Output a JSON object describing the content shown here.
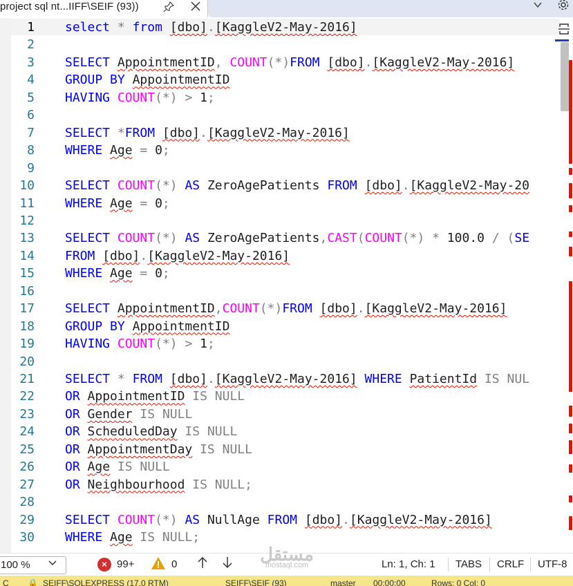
{
  "tab": {
    "title": "project sql nt...IIFF\\SEIF (93))",
    "pin_icon": "pin-icon",
    "close_icon": "close-icon"
  },
  "editor": {
    "lines": [
      {
        "n": "1",
        "code": "select * from [dbo].[KaggleV2-May-2016]"
      },
      {
        "n": "2",
        "code": ""
      },
      {
        "n": "3",
        "code": "SELECT AppointmentID, COUNT(*)FROM [dbo].[KaggleV2-May-2016]"
      },
      {
        "n": "4",
        "code": "GROUP BY AppointmentID"
      },
      {
        "n": "5",
        "code": "HAVING COUNT(*) > 1;"
      },
      {
        "n": "6",
        "code": ""
      },
      {
        "n": "7",
        "code": "SELECT *FROM [dbo].[KaggleV2-May-2016]"
      },
      {
        "n": "8",
        "code": "WHERE Age = 0;"
      },
      {
        "n": "9",
        "code": ""
      },
      {
        "n": "10",
        "code": "SELECT COUNT(*) AS ZeroAgePatients FROM [dbo].[KaggleV2-May-20"
      },
      {
        "n": "11",
        "code": "WHERE Age = 0;"
      },
      {
        "n": "12",
        "code": ""
      },
      {
        "n": "13",
        "code": "SELECT COUNT(*) AS ZeroAgePatients,CAST(COUNT(*) * 100.0 / (SE"
      },
      {
        "n": "14",
        "code": "FROM [dbo].[KaggleV2-May-2016]"
      },
      {
        "n": "15",
        "code": "WHERE Age = 0;"
      },
      {
        "n": "16",
        "code": ""
      },
      {
        "n": "17",
        "code": "SELECT AppointmentID,COUNT(*)FROM [dbo].[KaggleV2-May-2016]"
      },
      {
        "n": "18",
        "code": "GROUP BY AppointmentID"
      },
      {
        "n": "19",
        "code": "HAVING COUNT(*) > 1;"
      },
      {
        "n": "20",
        "code": ""
      },
      {
        "n": "21",
        "code": "SELECT * FROM [dbo].[KaggleV2-May-2016] WHERE PatientId IS NUL"
      },
      {
        "n": "22",
        "code": "OR AppointmentID IS NULL"
      },
      {
        "n": "23",
        "code": "OR Gender IS NULL"
      },
      {
        "n": "24",
        "code": "OR ScheduledDay IS NULL"
      },
      {
        "n": "25",
        "code": "OR AppointmentDay IS NULL"
      },
      {
        "n": "26",
        "code": "OR Age IS NULL"
      },
      {
        "n": "27",
        "code": "OR Neighbourhood IS NULL;"
      },
      {
        "n": "28",
        "code": ""
      },
      {
        "n": "29",
        "code": "SELECT COUNT(*) AS NullAge FROM [dbo].[KaggleV2-May-2016]"
      },
      {
        "n": "30",
        "code": "WHERE Age IS NULL;"
      }
    ]
  },
  "status": {
    "zoom": "100 %",
    "errors": "99+",
    "warnings": "0",
    "position": "Ln: 1, Ch: 1",
    "indent": "TABS",
    "line_ending": "CRLF",
    "encoding": "UTF-8",
    "watermark_ar": "مستقل",
    "watermark_en": "mostaql.com"
  },
  "infobar": {
    "items": [
      "C",
      "SEIFF\\SQLEXPRESS (17.0 RTM)",
      "SEIFF\\SEIF (93)",
      "master",
      "00:00:00",
      "Rows: 0 Col: 0"
    ]
  },
  "colors": {
    "keyword": "#0000ff",
    "function": "#ff00ff",
    "operator": "#808080",
    "squiggle": "#e51400",
    "line_number": "#237893",
    "tab_strip": "#dfe6f2",
    "info_bar": "#f5e68c"
  }
}
